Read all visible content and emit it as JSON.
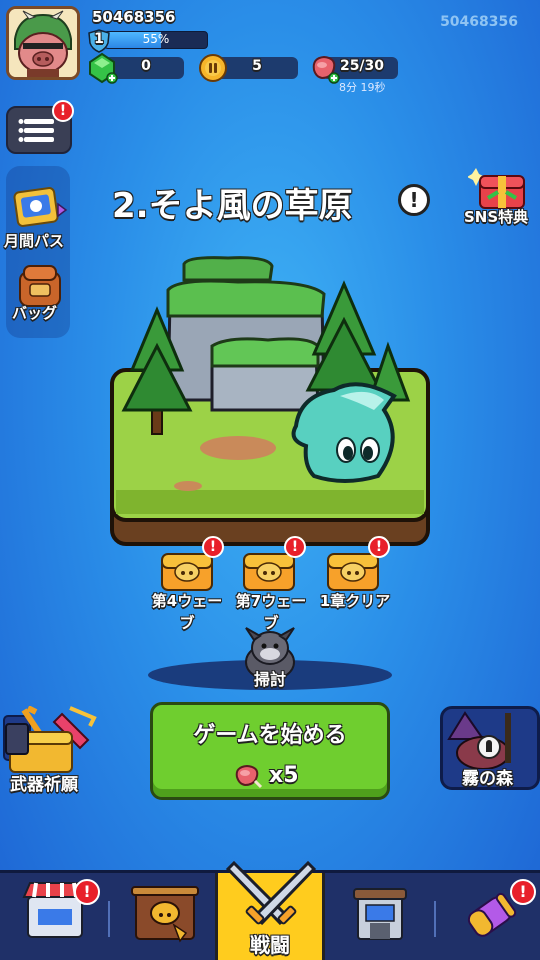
{
  "player": {
    "id": "50468356",
    "id_right": "50468356",
    "level": "1",
    "xp_percent": 55,
    "xp_label": "55%"
  },
  "resources": {
    "gems": "0",
    "coins": "5",
    "stamina": "25/30",
    "stamina_timer": "8分 19秒"
  },
  "side": {
    "monthly_pass": "月間パス",
    "bag": "バッグ",
    "sns": "SNS特典"
  },
  "stage": {
    "title": "2.そよ風の草原",
    "info": "!"
  },
  "chests": [
    {
      "label": "第4ウェー\nブ"
    },
    {
      "label": "第7ウェー\nブ"
    },
    {
      "label": "1章クリア"
    }
  ],
  "sweep": {
    "label": "掃討"
  },
  "start": {
    "label": "ゲームを始める",
    "cost": "x5"
  },
  "events": {
    "left": "武器祈願",
    "right": "霧の森"
  },
  "nav": {
    "battle": "戦闘"
  },
  "badges": {
    "alert": "!"
  },
  "colors": {
    "bg": "#2a8ee8",
    "start_green": "#6fce2f",
    "nav_active": "#ffcc1e",
    "badge_red": "#e8202a"
  }
}
